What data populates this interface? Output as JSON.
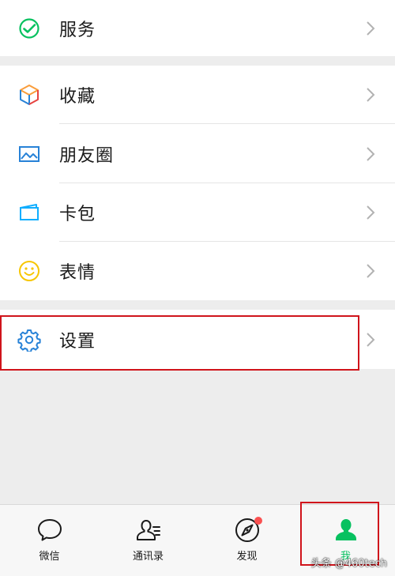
{
  "menu": {
    "service": {
      "label": "服务",
      "icon": "service-check-icon"
    },
    "favorites": {
      "label": "收藏",
      "icon": "favorites-cube-icon"
    },
    "moments": {
      "label": "朋友圈",
      "icon": "moments-image-icon"
    },
    "cards": {
      "label": "卡包",
      "icon": "card-wallet-icon"
    },
    "stickers": {
      "label": "表情",
      "icon": "smiley-icon"
    },
    "settings": {
      "label": "设置",
      "icon": "gear-icon"
    }
  },
  "tabbar": {
    "chats": {
      "label": "微信",
      "icon": "chat-bubble-icon"
    },
    "contacts": {
      "label": "通讯录",
      "icon": "contacts-icon"
    },
    "discover": {
      "label": "发现",
      "icon": "compass-icon",
      "has_badge": true
    },
    "me": {
      "label": "我",
      "icon": "person-icon",
      "active": true
    }
  },
  "colors": {
    "accent_green": "#07c160",
    "highlight_red": "#d0141b",
    "badge_red": "#fa5151",
    "background": "#ededed"
  },
  "watermark": "头条 @460tech"
}
